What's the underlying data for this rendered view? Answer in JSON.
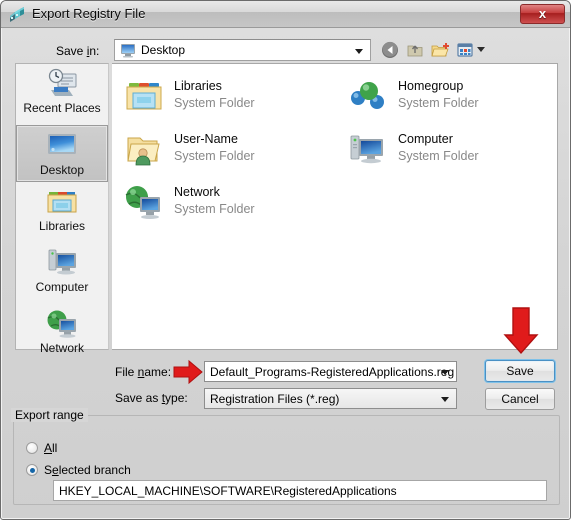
{
  "window": {
    "title": "Export Registry File",
    "icon": "registry-editor-icon",
    "close_label": "x"
  },
  "toolbar": {
    "save_in_label": "Save in:",
    "save_in_value": "Desktop",
    "save_in_icon": "desktop-monitor-icon",
    "buttons": [
      {
        "name": "back-button",
        "icon": "back-arrow-icon",
        "tooltip": "Back"
      },
      {
        "name": "up-button",
        "icon": "up-folder-icon",
        "tooltip": "Up One Level"
      },
      {
        "name": "new-folder-button",
        "icon": "new-folder-icon",
        "tooltip": "Create New Folder"
      },
      {
        "name": "views-button",
        "icon": "views-grid-icon",
        "tooltip": "Views"
      }
    ]
  },
  "places_bar": {
    "items": [
      {
        "label": "Recent Places",
        "icon": "recent-places-icon",
        "selected": false
      },
      {
        "label": "Desktop",
        "icon": "desktop-monitor-icon",
        "selected": true
      },
      {
        "label": "Libraries",
        "icon": "libraries-folder-icon",
        "selected": false
      },
      {
        "label": "Computer",
        "icon": "computer-monitor-icon",
        "selected": false
      },
      {
        "label": "Network",
        "icon": "network-globe-icon",
        "selected": false
      }
    ]
  },
  "file_list": {
    "items": [
      {
        "name": "Libraries",
        "type": "System Folder",
        "icon": "libraries-folder-icon",
        "column": 0,
        "row": 0
      },
      {
        "name": "Homegroup",
        "type": "System Folder",
        "icon": "homegroup-icon",
        "column": 1,
        "row": 0
      },
      {
        "name": "User-Name",
        "type": "System Folder",
        "icon": "user-folder-icon",
        "column": 0,
        "row": 1
      },
      {
        "name": "Computer",
        "type": "System Folder",
        "icon": "computer-monitor-icon",
        "column": 1,
        "row": 1
      },
      {
        "name": "Network",
        "type": "System Folder",
        "icon": "network-globe-icon",
        "column": 0,
        "row": 2
      }
    ]
  },
  "form": {
    "file_name_label": "File name:",
    "file_name_value": "Default_Programs-RegisteredApplications.reg",
    "save_as_type_label": "Save as type:",
    "save_as_type_value": "Registration Files (*.reg)",
    "save_button": "Save",
    "cancel_button": "Cancel"
  },
  "export_range": {
    "group_title": "Export range",
    "options": [
      {
        "label": "All",
        "selected": false
      },
      {
        "label": "Selected branch",
        "selected": true
      }
    ],
    "branch_path": "HKEY_LOCAL_MACHINE\\SOFTWARE\\RegisteredApplications"
  },
  "annotations": [
    {
      "name": "file-name-arrow",
      "direction": "right",
      "color": "#e01b1b"
    },
    {
      "name": "save-button-arrow",
      "direction": "down",
      "color": "#e01b1b"
    }
  ],
  "colors": {
    "accent_red": "#e01b1b",
    "dialog_bg": "#d6d6d6",
    "focus_blue": "#4a90c4"
  }
}
